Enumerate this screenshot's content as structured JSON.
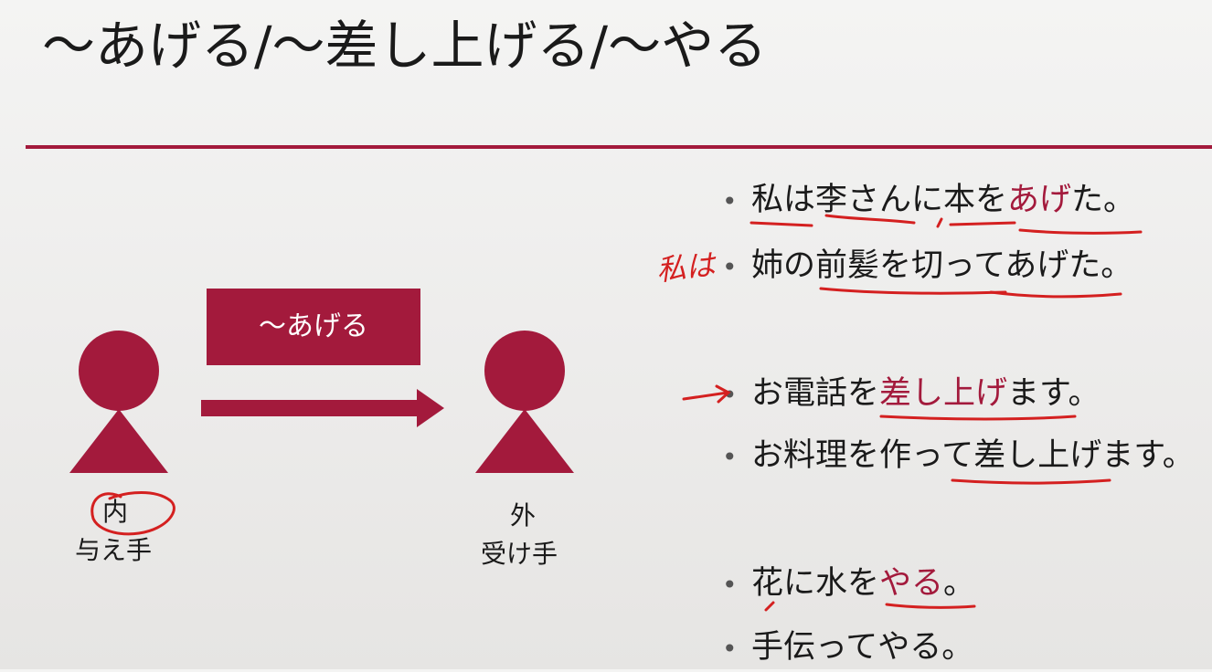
{
  "title": "～あげる/～差し上げる/～やる",
  "diagram": {
    "verb_box": "～あげる",
    "giver": {
      "line1": "内",
      "line2": "与え手"
    },
    "receiver": {
      "line1": "外",
      "line2": "受け手"
    },
    "accent_color": "#a31a3c"
  },
  "examples": [
    {
      "pre": "私は李さんに本を",
      "hl": "あげ",
      "post": "た。"
    },
    {
      "pre": "姉の前髪を切ってあげた。",
      "hl": "",
      "post": ""
    },
    {
      "pre": "お電話を",
      "hl": "差し上げ",
      "post": "ます。"
    },
    {
      "pre": "お料理を作って差し上げます。",
      "hl": "",
      "post": ""
    },
    {
      "pre": "花に水を",
      "hl": "やる",
      "post": "。"
    },
    {
      "pre": "手伝ってやる。",
      "hl": "",
      "post": ""
    }
  ],
  "handwriting": {
    "note": "私は",
    "ink_color": "#d42020"
  }
}
